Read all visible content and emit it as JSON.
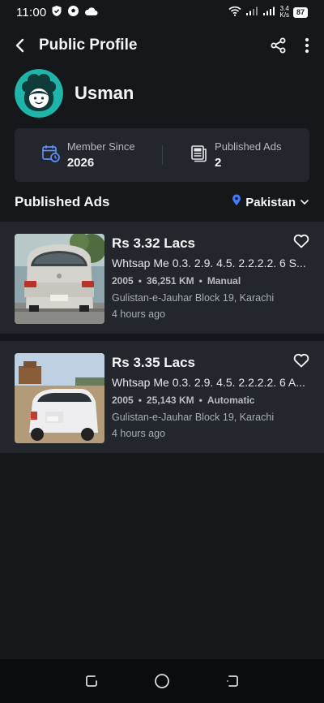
{
  "status_bar": {
    "time": "11:00",
    "speed": "3.4",
    "speed_unit": "K/s",
    "battery": "87"
  },
  "header": {
    "title": "Public Profile",
    "icons": [
      "back-arrow-icon",
      "share-icon",
      "more-vertical-icon"
    ]
  },
  "profile": {
    "name": "Usman"
  },
  "stats": {
    "member_since_label": "Member Since",
    "member_since_value": "2026",
    "published_ads_label": "Published Ads",
    "published_ads_value": "2"
  },
  "section": {
    "title": "Published Ads",
    "location": "Pakistan"
  },
  "ads": [
    {
      "price": "Rs 3.32 Lacs",
      "title": "Whtsap Me 0.3. 2.9. 4.5. 2.2.2.2. 6 S...",
      "year": "2005",
      "mileage": "36,251 KM",
      "transmission": "Manual",
      "location": "Gulistan-e-Jauhar Block 19, Karachi",
      "time": "4 hours ago"
    },
    {
      "price": "Rs 3.35 Lacs",
      "title": "Whtsap Me 0.3. 2.9. 4.5. 2.2.2.2. 6 A...",
      "year": "2005",
      "mileage": "25,143 KM",
      "transmission": "Automatic",
      "location": "Gulistan-e-Jauhar Block 19, Karachi",
      "time": "4 hours ago"
    }
  ],
  "colors": {
    "background": "#15171b",
    "card": "#23262c",
    "avatar_accent": "#1fb5a8",
    "location_pin": "#3d7bf7"
  }
}
